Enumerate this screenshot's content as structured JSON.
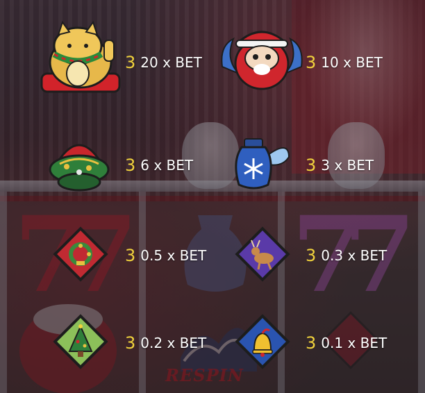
{
  "paytable": [
    {
      "symbol_icon": "lucky-cat-icon",
      "count": "3",
      "payout": "20 x BET"
    },
    {
      "symbol_icon": "daruma-icon",
      "count": "3",
      "payout": "10 x BET"
    },
    {
      "symbol_icon": "christmas-wreath-pot-icon",
      "count": "3",
      "payout": "6 x BET"
    },
    {
      "symbol_icon": "snowflake-vase-icon",
      "count": "3",
      "payout": "3 x BET"
    },
    {
      "symbol_icon": "wreath-card-icon",
      "count": "3",
      "payout": "0.5 x BET"
    },
    {
      "symbol_icon": "reindeer-card-icon",
      "count": "3",
      "payout": "0.3 x BET"
    },
    {
      "symbol_icon": "tree-card-icon",
      "count": "3",
      "payout": "0.2 x BET"
    },
    {
      "symbol_icon": "bell-card-icon",
      "count": "3",
      "payout": "0.1 x BET"
    }
  ],
  "background": {
    "respin_text": "RESPIN"
  },
  "colors": {
    "count": "#f0d23c",
    "payout": "#ffffff"
  }
}
